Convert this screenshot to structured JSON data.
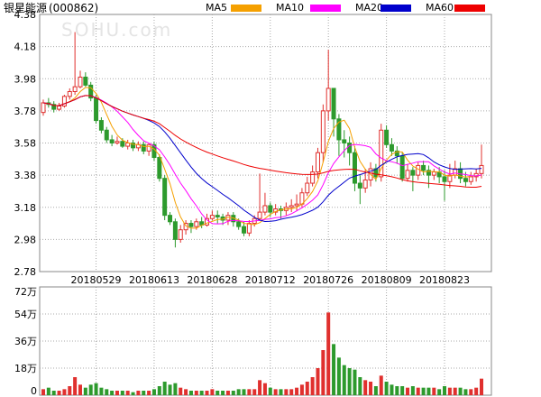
{
  "header": {
    "stock_name": "银星能源",
    "stock_code": "(000862)",
    "watermark": "SOHU.com"
  },
  "legend": [
    {
      "label": "MA5",
      "color": "#f5a000"
    },
    {
      "label": "MA10",
      "color": "#ff00ff"
    },
    {
      "label": "MA20",
      "color": "#0000cc"
    },
    {
      "label": "MA60",
      "color": "#ee0000"
    }
  ],
  "colors": {
    "up": "#e0302e",
    "down": "#2d9a2d",
    "grid": "#aaaaaa",
    "frame": "#888888"
  },
  "chart_data": [
    {
      "type": "candlestick",
      "price_ticks": [
        "4.38",
        "4.18",
        "3.98",
        "3.78",
        "3.58",
        "3.38",
        "3.18",
        "2.98",
        "2.78"
      ],
      "ylim": [
        2.78,
        4.38
      ],
      "x_tick_labels": [
        "20180529",
        "20180613",
        "20180628",
        "20180712",
        "20180726",
        "20180809",
        "20180823"
      ],
      "candles": [
        [
          3.77,
          3.83,
          3.85,
          3.75
        ],
        [
          3.83,
          3.82,
          3.86,
          3.8
        ],
        [
          3.82,
          3.79,
          3.84,
          3.77
        ],
        [
          3.79,
          3.81,
          3.83,
          3.78
        ],
        [
          3.81,
          3.87,
          3.88,
          3.8
        ],
        [
          3.87,
          3.9,
          3.92,
          3.85
        ],
        [
          3.9,
          3.93,
          4.27,
          3.88
        ],
        [
          3.93,
          3.99,
          4.03,
          3.92
        ],
        [
          3.99,
          3.94,
          4.02,
          3.93
        ],
        [
          3.94,
          3.86,
          3.96,
          3.84
        ],
        [
          3.86,
          3.72,
          3.88,
          3.7
        ],
        [
          3.72,
          3.66,
          3.74,
          3.64
        ],
        [
          3.66,
          3.6,
          3.68,
          3.58
        ],
        [
          3.6,
          3.58,
          3.63,
          3.56
        ],
        [
          3.58,
          3.59,
          3.62,
          3.57
        ],
        [
          3.59,
          3.56,
          3.61,
          3.55
        ],
        [
          3.56,
          3.58,
          3.6,
          3.54
        ],
        [
          3.58,
          3.55,
          3.6,
          3.53
        ],
        [
          3.55,
          3.57,
          3.59,
          3.53
        ],
        [
          3.57,
          3.53,
          3.59,
          3.51
        ],
        [
          3.53,
          3.57,
          3.58,
          3.5
        ],
        [
          3.57,
          3.49,
          3.59,
          3.47
        ],
        [
          3.49,
          3.36,
          3.51,
          3.34
        ],
        [
          3.36,
          3.13,
          3.38,
          3.1
        ],
        [
          3.13,
          3.09,
          3.15,
          3.07
        ],
        [
          3.09,
          2.98,
          3.11,
          2.93
        ],
        [
          2.98,
          3.04,
          3.07,
          2.96
        ],
        [
          3.04,
          3.08,
          3.1,
          3.01
        ],
        [
          3.08,
          3.06,
          3.1,
          3.02
        ],
        [
          3.06,
          3.09,
          3.11,
          3.04
        ],
        [
          3.09,
          3.07,
          3.12,
          3.05
        ],
        [
          3.07,
          3.11,
          3.14,
          3.06
        ],
        [
          3.11,
          3.13,
          3.16,
          3.1
        ],
        [
          3.13,
          3.12,
          3.16,
          3.08
        ],
        [
          3.12,
          3.1,
          3.14,
          3.07
        ],
        [
          3.1,
          3.13,
          3.15,
          3.07
        ],
        [
          3.13,
          3.09,
          3.15,
          3.06
        ],
        [
          3.09,
          3.06,
          3.11,
          3.04
        ],
        [
          3.06,
          3.02,
          3.09,
          3.0
        ],
        [
          3.02,
          3.08,
          3.1,
          3.0
        ],
        [
          3.08,
          3.11,
          3.13,
          3.06
        ],
        [
          3.11,
          3.15,
          3.39,
          3.1
        ],
        [
          3.15,
          3.19,
          3.27,
          3.13
        ],
        [
          3.19,
          3.15,
          3.21,
          3.12
        ],
        [
          3.15,
          3.17,
          3.2,
          3.13
        ],
        [
          3.17,
          3.16,
          3.19,
          3.11
        ],
        [
          3.16,
          3.18,
          3.21,
          3.13
        ],
        [
          3.18,
          3.19,
          3.23,
          3.15
        ],
        [
          3.19,
          3.2,
          3.26,
          3.16
        ],
        [
          3.2,
          3.27,
          3.3,
          3.18
        ],
        [
          3.27,
          3.33,
          3.37,
          3.25
        ],
        [
          3.33,
          3.4,
          3.44,
          3.31
        ],
        [
          3.4,
          3.52,
          3.55,
          3.36
        ],
        [
          3.52,
          3.78,
          3.82,
          3.46
        ],
        [
          3.78,
          3.92,
          4.16,
          3.72
        ],
        [
          3.92,
          3.73,
          3.8,
          3.62
        ],
        [
          3.73,
          3.6,
          3.76,
          3.5
        ],
        [
          3.6,
          3.58,
          3.66,
          3.49
        ],
        [
          3.58,
          3.52,
          3.62,
          3.44
        ],
        [
          3.52,
          3.33,
          3.56,
          3.28
        ],
        [
          3.33,
          3.3,
          3.38,
          3.2
        ],
        [
          3.3,
          3.35,
          3.42,
          3.27
        ],
        [
          3.35,
          3.42,
          3.46,
          3.31
        ],
        [
          3.42,
          3.37,
          3.45,
          3.34
        ],
        [
          3.37,
          3.66,
          3.7,
          3.34
        ],
        [
          3.66,
          3.57,
          3.69,
          3.55
        ],
        [
          3.57,
          3.53,
          3.61,
          3.5
        ],
        [
          3.53,
          3.5,
          3.56,
          3.45
        ],
        [
          3.5,
          3.36,
          3.52,
          3.34
        ],
        [
          3.36,
          3.41,
          3.45,
          3.34
        ],
        [
          3.41,
          3.38,
          3.43,
          3.28
        ],
        [
          3.38,
          3.44,
          3.46,
          3.35
        ],
        [
          3.44,
          3.41,
          3.47,
          3.38
        ],
        [
          3.41,
          3.38,
          3.44,
          3.3
        ],
        [
          3.38,
          3.4,
          3.42,
          3.35
        ],
        [
          3.4,
          3.37,
          3.43,
          3.33
        ],
        [
          3.37,
          3.34,
          3.41,
          3.22
        ],
        [
          3.34,
          3.38,
          3.45,
          3.3
        ],
        [
          3.38,
          3.42,
          3.47,
          3.36
        ],
        [
          3.42,
          3.36,
          3.46,
          3.33
        ],
        [
          3.36,
          3.34,
          3.4,
          3.31
        ],
        [
          3.34,
          3.37,
          3.4,
          3.32
        ],
        [
          3.37,
          3.39,
          3.42,
          3.34
        ],
        [
          3.39,
          3.44,
          3.57,
          3.36
        ]
      ],
      "volume_ticks": [
        "72万",
        "54万",
        "36万",
        "18万",
        "0"
      ],
      "volume_max": 72,
      "volume_unit": "万",
      "volumes": [
        4,
        5,
        3,
        3,
        4,
        6,
        12,
        7,
        5,
        7,
        8,
        5,
        4,
        3,
        3,
        3,
        3,
        2,
        3,
        3,
        3,
        4,
        6,
        9,
        7,
        8,
        5,
        4,
        3,
        3,
        3,
        3,
        4,
        3,
        3,
        3,
        3,
        4,
        4,
        4,
        4,
        10,
        8,
        5,
        4,
        4,
        4,
        4,
        5,
        7,
        9,
        12,
        18,
        30,
        55,
        34,
        25,
        20,
        18,
        17,
        12,
        10,
        9,
        6,
        13,
        9,
        7,
        6,
        6,
        5,
        6,
        5,
        5,
        5,
        5,
        4,
        6,
        5,
        5,
        5,
        4,
        4,
        5,
        11
      ]
    }
  ]
}
